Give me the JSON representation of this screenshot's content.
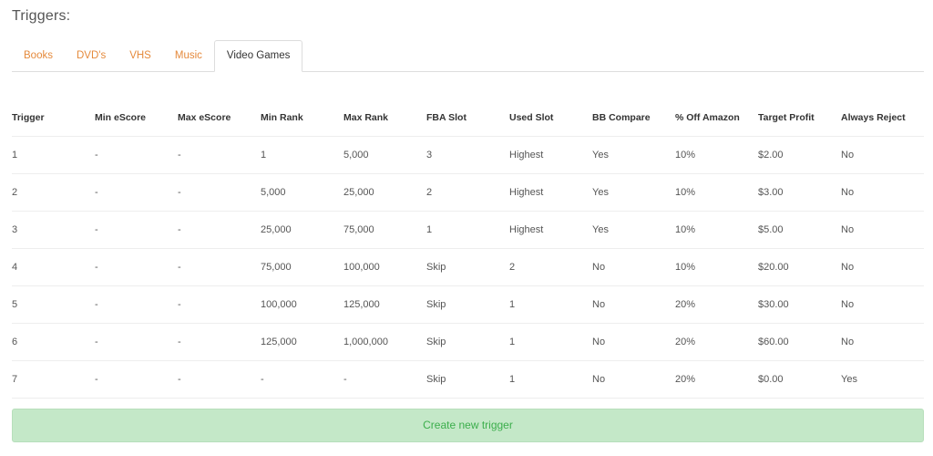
{
  "page": {
    "title": "Triggers:"
  },
  "tabs": [
    {
      "label": "Books"
    },
    {
      "label": "DVD's"
    },
    {
      "label": "VHS"
    },
    {
      "label": "Music"
    },
    {
      "label": "Video Games",
      "active": true
    }
  ],
  "table": {
    "headers": [
      "Trigger",
      "Min eScore",
      "Max eScore",
      "Min Rank",
      "Max Rank",
      "FBA Slot",
      "Used Slot",
      "BB Compare",
      "% Off Amazon",
      "Target Profit",
      "Always Reject"
    ],
    "rows": [
      [
        "1",
        "-",
        "-",
        "1",
        "5,000",
        "3",
        "Highest",
        "Yes",
        "10%",
        "$2.00",
        "No"
      ],
      [
        "2",
        "-",
        "-",
        "5,000",
        "25,000",
        "2",
        "Highest",
        "Yes",
        "10%",
        "$3.00",
        "No"
      ],
      [
        "3",
        "-",
        "-",
        "25,000",
        "75,000",
        "1",
        "Highest",
        "Yes",
        "10%",
        "$5.00",
        "No"
      ],
      [
        "4",
        "-",
        "-",
        "75,000",
        "100,000",
        "Skip",
        "2",
        "No",
        "10%",
        "$20.00",
        "No"
      ],
      [
        "5",
        "-",
        "-",
        "100,000",
        "125,000",
        "Skip",
        "1",
        "No",
        "20%",
        "$30.00",
        "No"
      ],
      [
        "6",
        "-",
        "-",
        "125,000",
        "1,000,000",
        "Skip",
        "1",
        "No",
        "20%",
        "$60.00",
        "No"
      ],
      [
        "7",
        "-",
        "-",
        "-",
        "-",
        "Skip",
        "1",
        "No",
        "20%",
        "$0.00",
        "Yes"
      ]
    ]
  },
  "actions": {
    "create_label": "Create new trigger"
  },
  "colors": {
    "tab_link": "#e58a3c",
    "button_bg": "#c4e8c8",
    "button_text": "#3cae4c"
  }
}
